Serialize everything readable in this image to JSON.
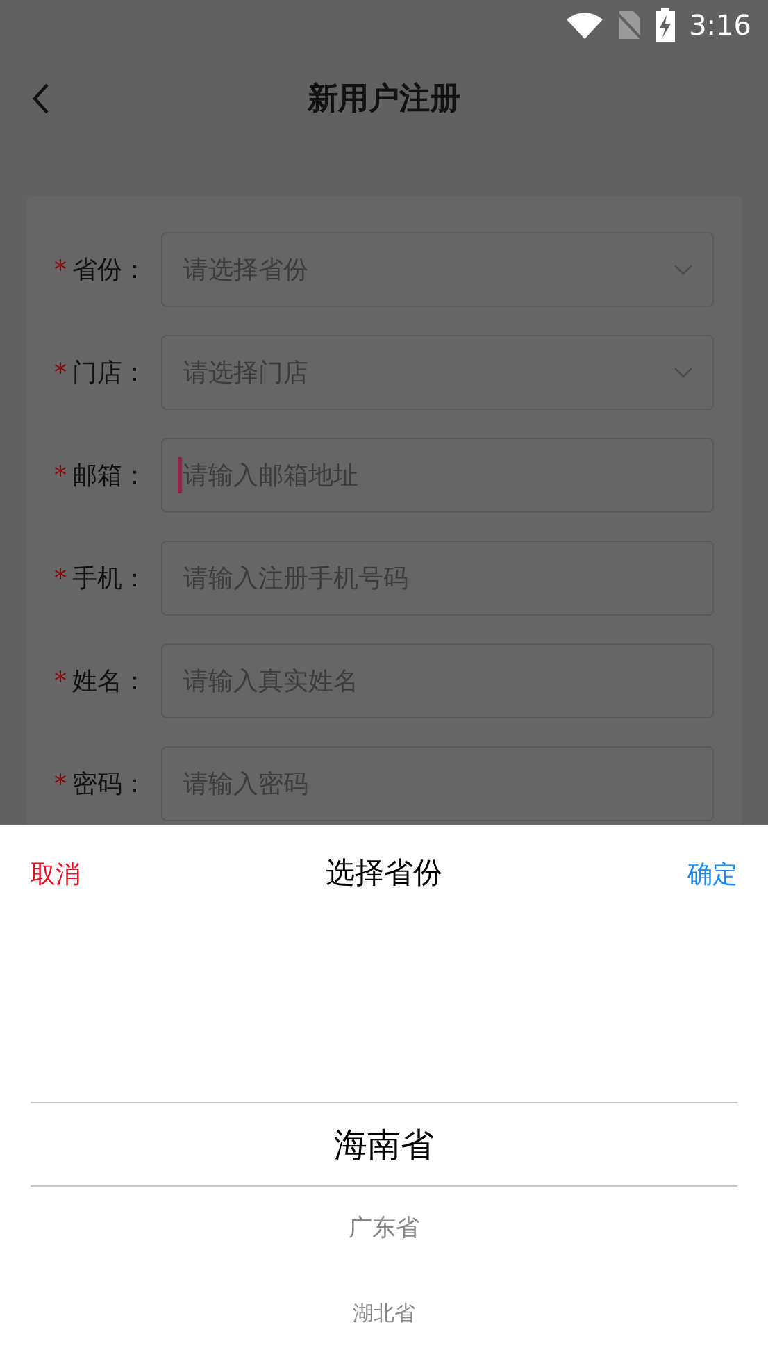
{
  "status_bar": {
    "time": "3:16"
  },
  "header": {
    "title": "新用户注册"
  },
  "form": {
    "fields": [
      {
        "label": "省份：",
        "mark": "*",
        "kind": "select",
        "placeholder": "请选择省份",
        "focused": false
      },
      {
        "label": "门店：",
        "mark": "*",
        "kind": "select",
        "placeholder": "请选择门店",
        "focused": false
      },
      {
        "label": "邮箱：",
        "mark": "*",
        "kind": "input",
        "placeholder": "请输入邮箱地址",
        "focused": true
      },
      {
        "label": "手机：",
        "mark": "*",
        "kind": "input",
        "placeholder": "请输入注册手机号码",
        "focused": false
      },
      {
        "label": "姓名：",
        "mark": "*",
        "kind": "input",
        "placeholder": "请输入真实姓名",
        "focused": false
      },
      {
        "label": "密码：",
        "mark": "*",
        "kind": "input",
        "placeholder": "请输入密码",
        "focused": false
      }
    ]
  },
  "picker": {
    "cancel": "取消",
    "title": "选择省份",
    "confirm": "确定",
    "options": [
      {
        "label": "海南省",
        "selected": true
      },
      {
        "label": "广东省",
        "selected": false
      },
      {
        "label": "湖北省",
        "selected": false
      }
    ]
  }
}
